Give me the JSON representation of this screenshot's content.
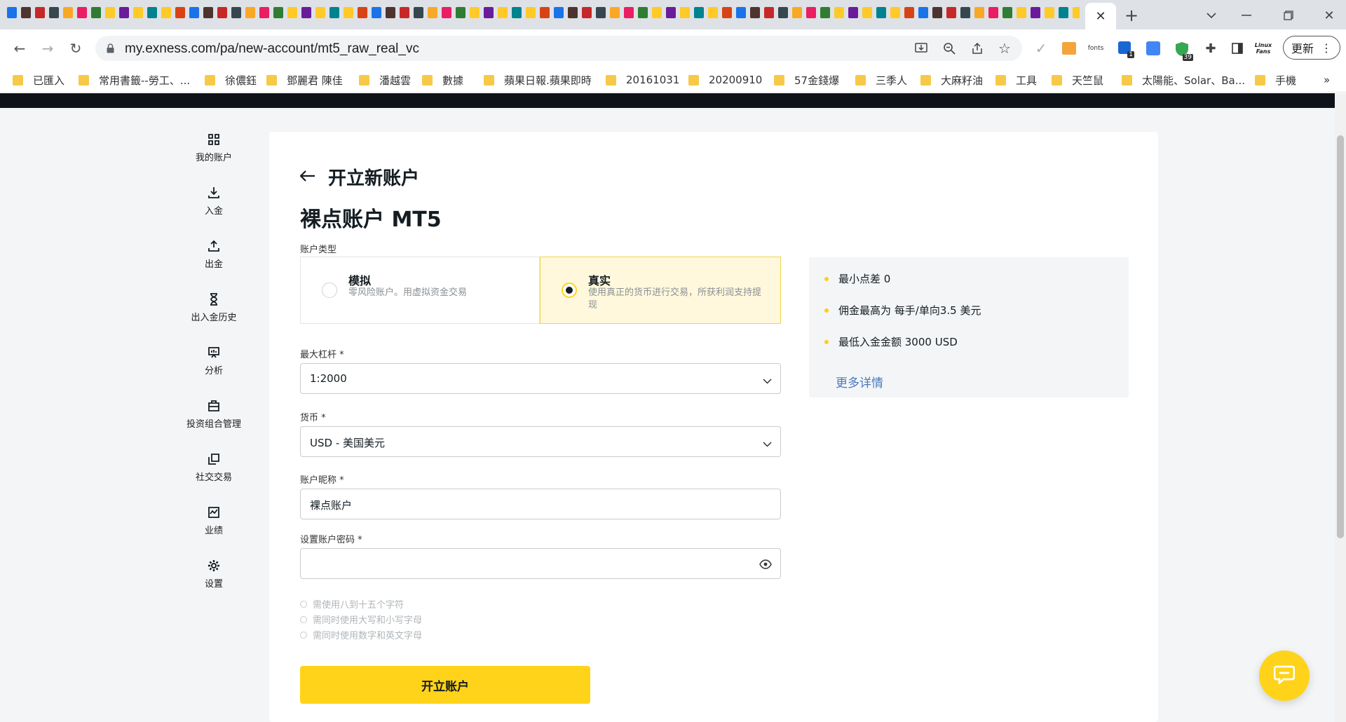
{
  "browser": {
    "url": "my.exness.com/pa/new-account/mt5_raw_real_vc",
    "update_label": "更新",
    "fonts_ext_label": "fonts",
    "ext_badge_1": "1",
    "ext_badge_39": "39",
    "linux_fans": "Linux Fans",
    "bookmarks": [
      "已匯入",
      "常用書籤--勞工、...",
      "徐儂鈺",
      "鄧麗君 陳佳",
      "潘越雲",
      "數據",
      "蘋果日報.蘋果即時",
      "20161031",
      "20200910",
      "57金錢爆",
      "三季人",
      "大麻籽油",
      "工具",
      "天竺鼠",
      "太陽能、Solar、Ba...",
      "手機"
    ],
    "bookmarks_more": "»"
  },
  "sidenav": {
    "items": [
      {
        "label": "我的账户",
        "icon": "grid-icon"
      },
      {
        "label": "入金",
        "icon": "download-icon"
      },
      {
        "label": "出金",
        "icon": "upload-icon"
      },
      {
        "label": "出入金历史",
        "icon": "hourglass-icon"
      },
      {
        "label": "分析",
        "icon": "presentation-icon"
      },
      {
        "label": "投资组合管理",
        "icon": "briefcase-icon"
      },
      {
        "label": "社交交易",
        "icon": "copy-icon"
      },
      {
        "label": "业绩",
        "icon": "chart-icon"
      },
      {
        "label": "设置",
        "icon": "gear-icon"
      }
    ]
  },
  "form": {
    "back_title": "开立新账户",
    "account_title": "裸点账户 MT5",
    "type_label": "账户类型",
    "demo": {
      "name": "模拟",
      "desc": "零风险账户。用虚拟资金交易"
    },
    "real": {
      "name": "真实",
      "desc": "使用真正的货币进行交易，所获利润支持提现"
    },
    "leverage_label": "最大杠杆 *",
    "leverage_value": "1:2000",
    "currency_label": "货币 *",
    "currency_value": "USD - 美国美元",
    "nickname_label": "账户昵称 *",
    "nickname_value": "裸点账户",
    "password_label": "设置账户密码 *",
    "password_value": "",
    "rules": [
      "需使用八到十五个字符",
      "需同时使用大写和小写字母",
      "需同时使用数字和英文字母"
    ],
    "submit_label": "开立账户"
  },
  "info": {
    "items": [
      "最小点差 0",
      "佣金最高为 每手/单向3.5 美元",
      "最低入金金额 3000 USD"
    ],
    "more_link": "更多详情"
  },
  "colors": {
    "accent": "#ffd31a",
    "link": "#4a79bf",
    "dark": "#141d22"
  }
}
